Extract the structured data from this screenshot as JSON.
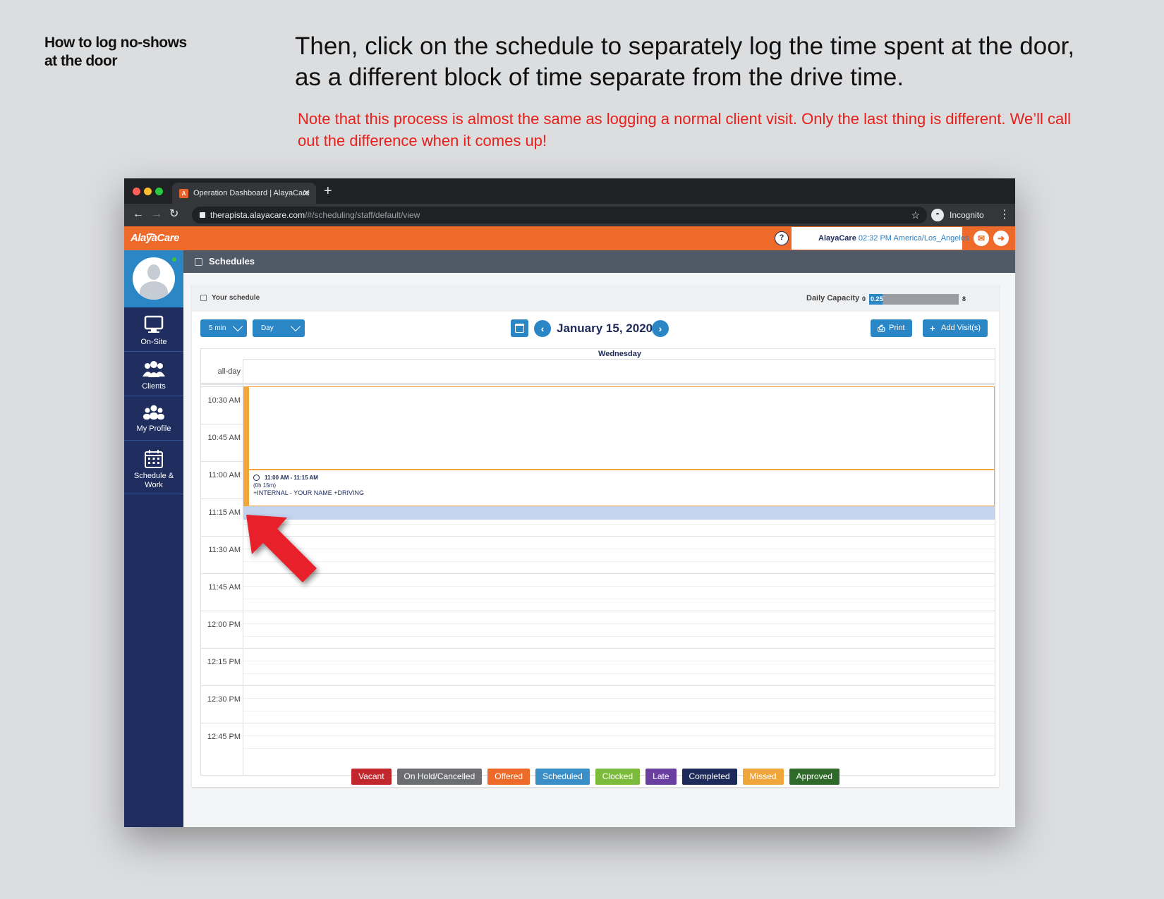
{
  "slide": {
    "side_heading": "How to log no-shows\nat the door",
    "instruction": "Then, click on the schedule to separately log the time spent at the door, as a different block of time separate from the drive time.",
    "note": "Note that this process is almost the same as logging a normal client visit. Only the last thing is different. We’ll call out the difference when it comes up!"
  },
  "browser": {
    "tab_title": "Operation Dashboard | AlayaCare",
    "url_host": "therapista.alayacare.com",
    "url_path": "/#/scheduling/staff/default/view",
    "incognito_label": "Incognito",
    "colors": {
      "close": "#ff5f57",
      "minimize": "#febc2e",
      "maximize": "#28c840"
    }
  },
  "header": {
    "logo": "AlayaCare",
    "help": "?",
    "user": "AlayaCare",
    "time": "02:32 PM",
    "timezone": "America/Los_Angeles",
    "brand_color": "#ed6a2a"
  },
  "sidebar": {
    "items": [
      {
        "label": "On-Site",
        "icon": "monitor-icon"
      },
      {
        "label": "Clients",
        "icon": "clients-icon"
      },
      {
        "label": "My Profile",
        "icon": "profile-group-icon"
      },
      {
        "label": "Schedule & Work",
        "icon": "calendar-icon"
      }
    ]
  },
  "page": {
    "title": "Schedules"
  },
  "schedule": {
    "panel_title": "Your schedule",
    "capacity_label": "Daily Capacity",
    "capacity_min": "0",
    "capacity_value": "0.25",
    "capacity_max": "8",
    "capacity_fraction": 0.15,
    "interval": "5 min",
    "view": "Day",
    "date": "January 15, 2020",
    "print_label": "Print",
    "add_label": "Add Visit(s)",
    "day_name": "Wednesday",
    "allday": "all-day",
    "time_labels": [
      "10:30 AM",
      "10:45 AM",
      "11:00 AM",
      "11:15 AM",
      "11:30 AM",
      "11:45 AM",
      "12:00 PM",
      "12:15 PM",
      "12:30 PM",
      "12:45 PM"
    ],
    "event": {
      "time": "11:00 AM - 11:15 AM",
      "duration": "(0h 15m)",
      "title": "+INTERNAL - YOUR NAME +DRIVING"
    }
  },
  "legend": [
    {
      "label": "Vacant",
      "color": "#c1272d"
    },
    {
      "label": "On Hold/Cancelled",
      "color": "#6d6e71"
    },
    {
      "label": "Offered",
      "color": "#ed6a2a"
    },
    {
      "label": "Scheduled",
      "color": "#3a8fc8"
    },
    {
      "label": "Clocked",
      "color": "#7dbb3c"
    },
    {
      "label": "Late",
      "color": "#6a3fa0"
    },
    {
      "label": "Completed",
      "color": "#1d2a5a"
    },
    {
      "label": "Missed",
      "color": "#f0a63a"
    },
    {
      "label": "Approved",
      "color": "#2f6a2a"
    }
  ]
}
